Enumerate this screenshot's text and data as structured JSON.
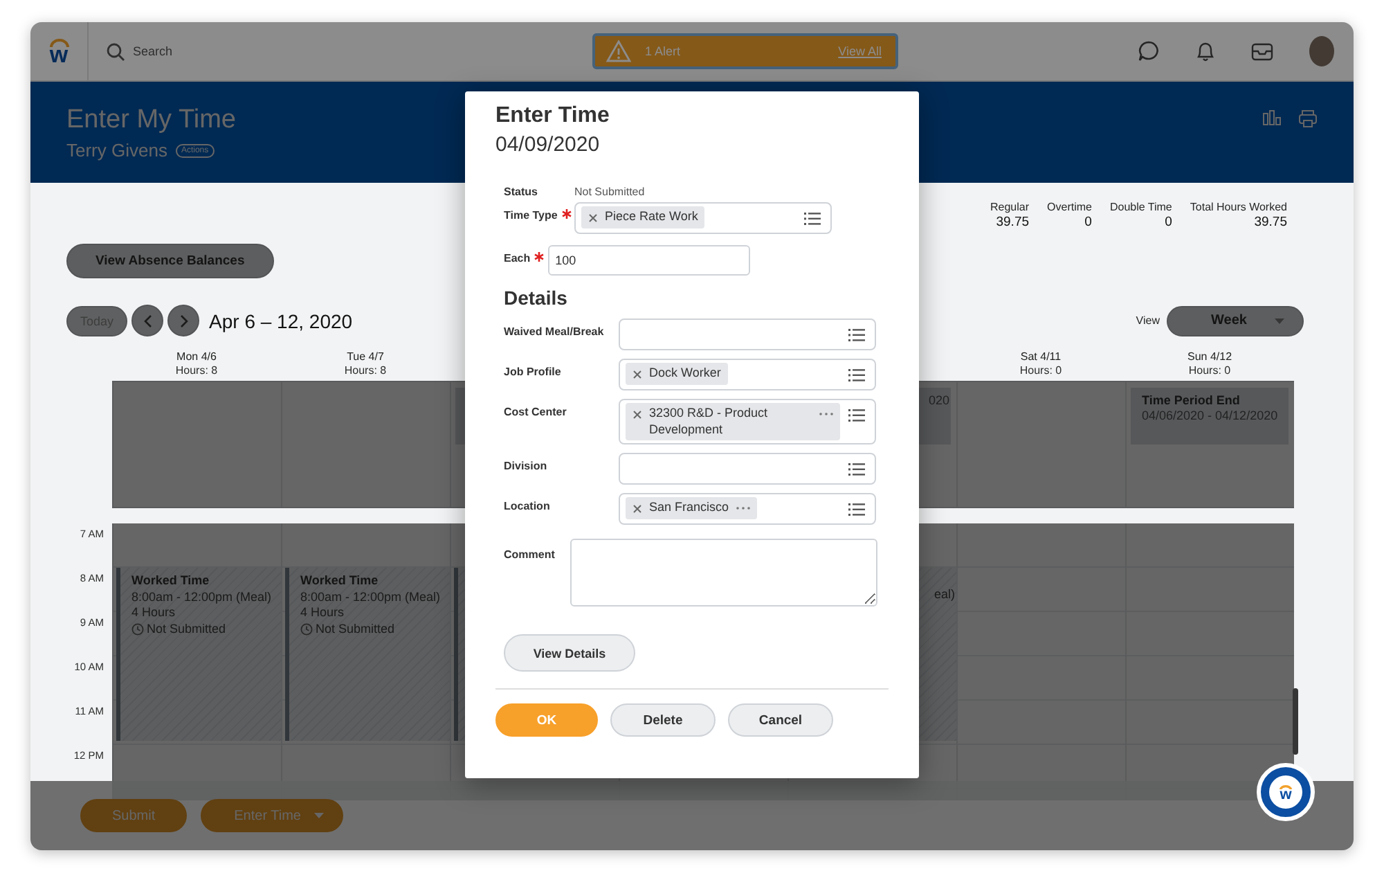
{
  "topbar": {
    "logo": "w",
    "search": {
      "placeholder": "Search"
    },
    "alert": {
      "text": "1 Alert",
      "link": "View All"
    }
  },
  "header": {
    "title": "Enter My Time",
    "subtitle": "Terry Givens",
    "actions": "Actions"
  },
  "summary": [
    {
      "label": "Regular",
      "value": "39.75"
    },
    {
      "label": "Overtime",
      "value": "0"
    },
    {
      "label": "Double Time",
      "value": "0"
    },
    {
      "label": "Total Hours Worked",
      "value": "39.75"
    }
  ],
  "absence_button": "View Absence Balances",
  "nav": {
    "today": "Today",
    "range": "Apr 6 – 12, 2020",
    "view_label": "View",
    "view_value": "Week"
  },
  "time_labels": [
    "7 AM",
    "8 AM",
    "9 AM",
    "10 AM",
    "11 AM",
    "12 PM"
  ],
  "days": [
    {
      "kind": "shown",
      "label": "Mon 4/6",
      "hours": "Hours: 8",
      "events": [
        {
          "kind": "worked",
          "title": "Worked Time",
          "time": "8:00am - 12:00pm (Meal)",
          "duration": "4 Hours",
          "status": "Not Submitted"
        }
      ]
    },
    {
      "kind": "shown",
      "label": "Tue 4/7",
      "hours": "Hours: 8",
      "events": [
        {
          "kind": "worked",
          "title": "Worked Time",
          "time": "8:00am - 12:00pm (Meal)",
          "duration": "4 Hours",
          "status": "Not Submitted"
        }
      ]
    },
    {
      "kind": "covered",
      "events": [
        {
          "kind": "all_day"
        },
        {
          "kind": "worked"
        }
      ]
    },
    {
      "kind": "covered"
    },
    {
      "kind": "covered",
      "events": [
        {
          "kind": "all_day",
          "fragment": "020"
        },
        {
          "kind": "worked",
          "fragment": "eal)"
        }
      ]
    },
    {
      "kind": "shown",
      "label": "Sat 4/11",
      "hours": "Hours: 0"
    },
    {
      "kind": "shown",
      "label": "Sun 4/12",
      "hours": "Hours: 0",
      "events": [
        {
          "kind": "all_day",
          "title": "Time Period End",
          "time": "04/06/2020 - 04/12/2020"
        }
      ]
    }
  ],
  "footer": {
    "buttons": [
      {
        "label": "Submit",
        "kind": "plain"
      },
      {
        "label": "Enter Time",
        "kind": "dropdown"
      }
    ]
  },
  "chat_button": {
    "logo": "w"
  },
  "modal": {
    "title": "Enter Time",
    "date": "04/09/2020",
    "fields": [
      {
        "kind": "status",
        "label": "Status",
        "value": "Not Submitted",
        "required": false
      },
      {
        "kind": "select",
        "label": "Time Type",
        "required": true,
        "chips": [
          {
            "text": "Piece Rate Work",
            "more": false
          }
        ]
      },
      {
        "kind": "text",
        "label": "Each",
        "required": true,
        "value": "100"
      }
    ],
    "details_heading": "Details",
    "details": [
      {
        "kind": "select",
        "label": "Waived Meal/Break",
        "required": false
      },
      {
        "kind": "select",
        "label": "Job Profile",
        "required": false,
        "chips": [
          {
            "text": "Dock Worker",
            "more": false
          }
        ]
      },
      {
        "kind": "select",
        "label": "Cost Center",
        "required": false,
        "chips": [
          {
            "text": "32300 R&D - Product Development",
            "more": true
          }
        ]
      },
      {
        "kind": "select",
        "label": "Division",
        "required": false
      },
      {
        "kind": "select",
        "label": "Location",
        "required": false,
        "chips": [
          {
            "text": "San Francisco",
            "more": true
          }
        ]
      },
      {
        "kind": "textarea",
        "label": "Comment",
        "required": false
      }
    ],
    "view_details": "View Details",
    "buttons": [
      {
        "label": "OK",
        "kind": "primary"
      },
      {
        "label": "Delete",
        "kind": "secondary"
      },
      {
        "label": "Cancel",
        "kind": "secondary"
      }
    ]
  }
}
